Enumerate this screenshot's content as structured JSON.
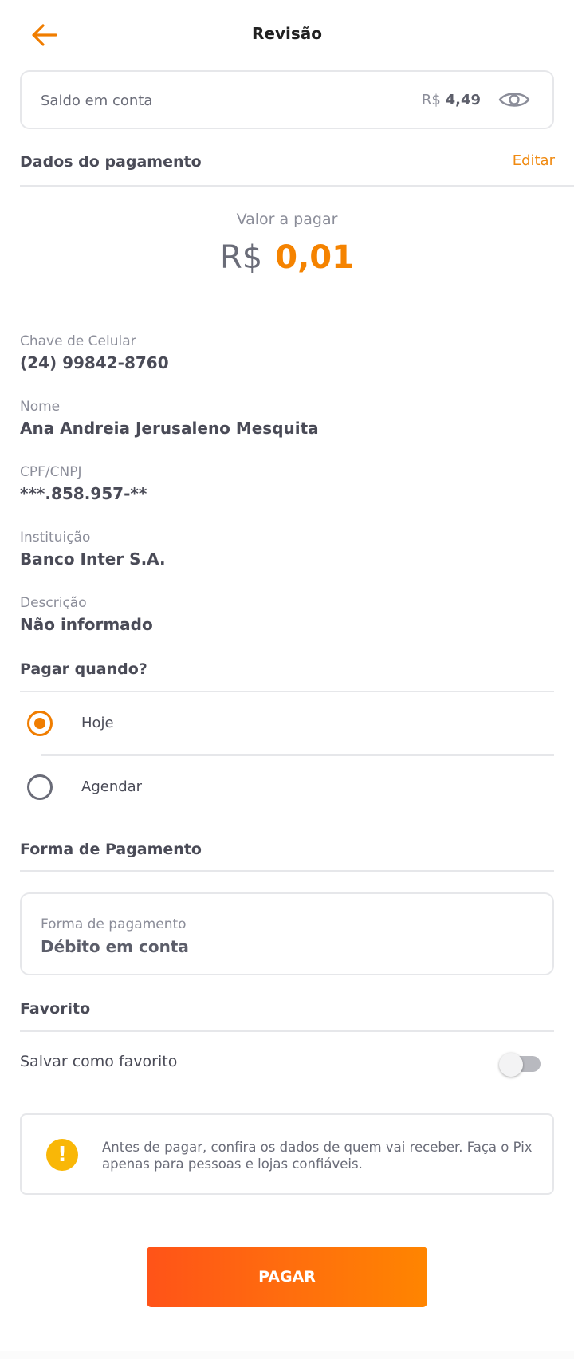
{
  "header": {
    "title": "Revisão"
  },
  "balance": {
    "label": "Saldo em conta",
    "currency": "R$",
    "value": "4,49"
  },
  "payment_data": {
    "title": "Dados do pagamento",
    "edit_label": "Editar",
    "amount_label": "Valor a pagar",
    "amount_currency": "R$",
    "amount_value": "0,01"
  },
  "fields": [
    {
      "label": "Chave de Celular",
      "value": "(24) 99842-8760"
    },
    {
      "label": "Nome",
      "value": "Ana Andreia Jerusaleno Mesquita"
    },
    {
      "label": "CPF/CNPJ",
      "value": "***.858.957-**"
    },
    {
      "label": "Instituição",
      "value": "Banco Inter S.A."
    },
    {
      "label": "Descrição",
      "value": "Não informado"
    }
  ],
  "schedule": {
    "title": "Pagar quando?",
    "options": [
      {
        "label": "Hoje",
        "selected": true
      },
      {
        "label": "Agendar",
        "selected": false
      }
    ]
  },
  "payment_method": {
    "title": "Forma de Pagamento",
    "field_label": "Forma de pagamento",
    "field_value": "Débito em conta"
  },
  "favorite": {
    "title": "Favorito",
    "toggle_label": "Salvar como favorito",
    "enabled": false
  },
  "warning": {
    "icon": "exclamation-icon",
    "text": "Antes de pagar, confira os dados de quem vai receber. Faça o Pix apenas para pessoas e lojas confiáveis."
  },
  "pay_button": {
    "label": "PAGAR"
  },
  "colors": {
    "accent": "#f58300",
    "button_gradient_start": "#ff5318",
    "button_gradient_end": "#ff8500",
    "warning": "#f9b707"
  }
}
